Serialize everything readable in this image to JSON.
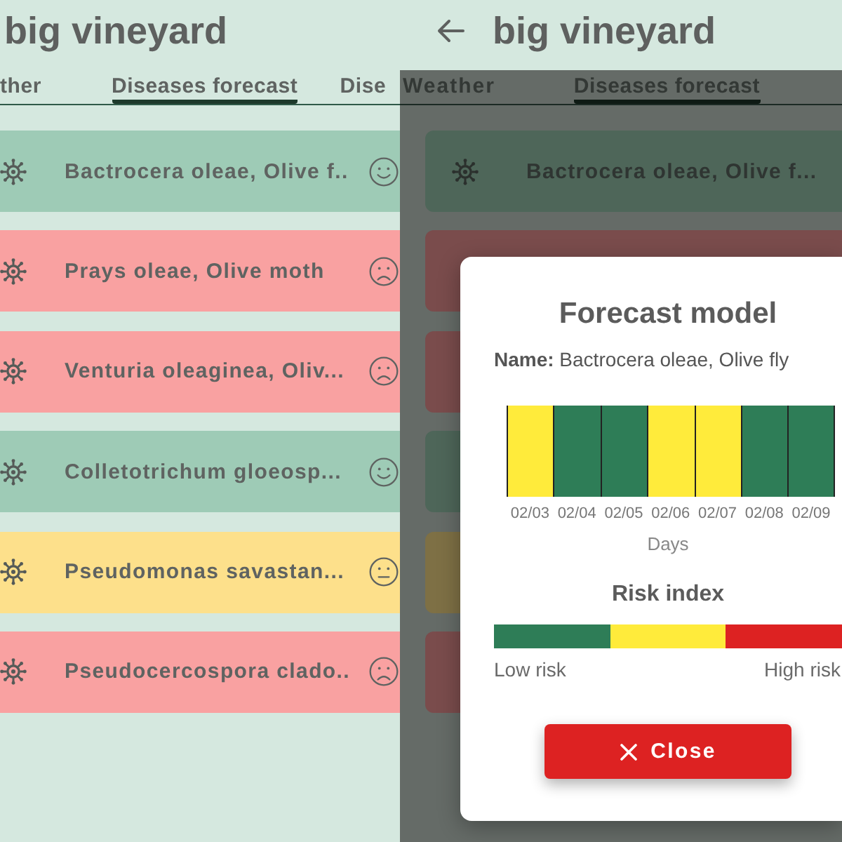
{
  "screens": [
    {
      "title": "big vineyard",
      "tabs": [
        {
          "label": "ther",
          "selected": false
        },
        {
          "label": "Diseases forecast",
          "selected": true
        },
        {
          "label": "Dise",
          "selected": false
        }
      ],
      "diseases": [
        {
          "name": "Bactrocera oleae, Olive f..",
          "color": "#9ecbb6",
          "kind": "happy"
        },
        {
          "name": "Prays oleae, Olive moth",
          "color": "#f9a1a1",
          "kind": "sad"
        },
        {
          "name": "Venturia oleaginea, Oliv...",
          "color": "#f9a1a1",
          "kind": "sad"
        },
        {
          "name": "Colletotrichum gloeosp...",
          "color": "#9ecbb6",
          "kind": "happy"
        },
        {
          "name": "Pseudomonas savastan...",
          "color": "#fde08b",
          "kind": "neutral"
        },
        {
          "name": "Pseudocercospora clado..",
          "color": "#f9a1a1",
          "kind": "sad"
        }
      ]
    },
    {
      "back_button": true,
      "title": "big vineyard",
      "dimmed": true,
      "tabs": [
        {
          "label": "Weather",
          "selected": false
        },
        {
          "label": "Diseases forecast",
          "selected": true
        }
      ],
      "diseases": [
        {
          "name": "Bactrocera oleae, Olive f...",
          "color": "#4e6659"
        },
        {
          "color": "#7a4c4c"
        },
        {
          "color": "#7a4c4c"
        },
        {
          "color": "#4e6659"
        },
        {
          "color": "#7e7045"
        },
        {
          "color": "#7a4c4c"
        }
      ],
      "dialog": {
        "title": "Forecast model",
        "name_line": "**Name:** Bactrocera oleae, Olive fly",
        "days": [
          {
            "date": "02/03",
            "color": "#ffeb3b"
          },
          {
            "date": "02/04",
            "color": "#2e7d57"
          },
          {
            "date": "02/05",
            "color": "#2e7d57"
          },
          {
            "date": "02/06",
            "color": "#ffeb3b"
          },
          {
            "date": "02/07",
            "color": "#ffeb3b"
          },
          {
            "date": "02/08",
            "color": "#2e7d57"
          },
          {
            "date": "02/09",
            "color": "#2e7d57"
          }
        ],
        "axis_label": "Days",
        "risk_title": "Risk index",
        "risk_scale": [
          {
            "color": "#2e7d57"
          },
          {
            "color": "#ffeb3b"
          },
          {
            "color": "#dd2222"
          }
        ],
        "low_label": "Low risk",
        "high_label": "High risk",
        "close_button": "Close"
      }
    }
  ]
}
